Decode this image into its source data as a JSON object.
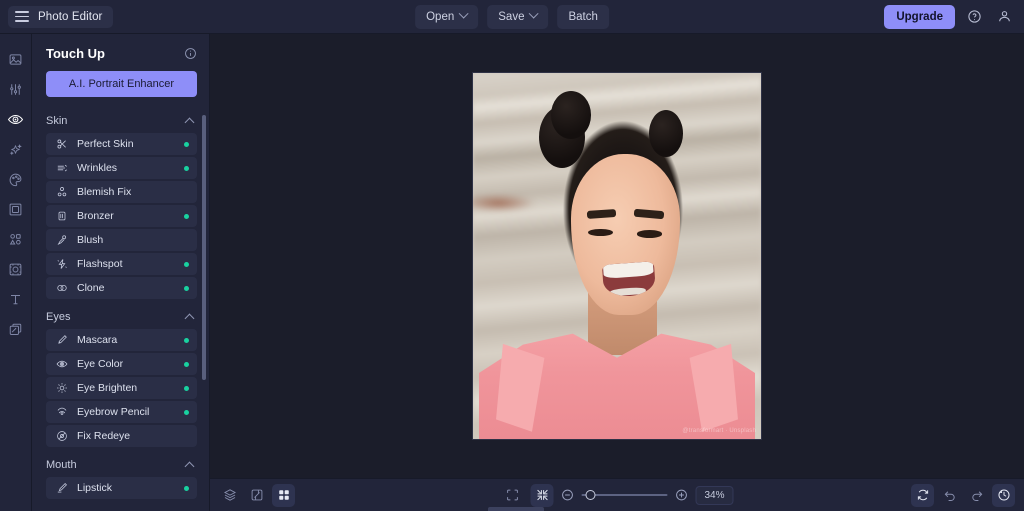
{
  "topbar": {
    "menu_icon": "hamburger-icon",
    "brand": "Photo Editor",
    "buttons": [
      {
        "label": "Open",
        "caret": true
      },
      {
        "label": "Save",
        "caret": true
      },
      {
        "label": "Batch",
        "caret": false
      }
    ],
    "upgrade_label": "Upgrade",
    "help_icon": "help-circle-icon",
    "account_icon": "user-account-icon"
  },
  "rail": {
    "items": [
      {
        "name": "image-icon",
        "active": false
      },
      {
        "name": "adjust-sliders-icon",
        "active": false
      },
      {
        "name": "eye-retouch-icon",
        "active": true
      },
      {
        "name": "sparkles-effects-icon",
        "active": false
      },
      {
        "name": "palette-color-icon",
        "active": false
      },
      {
        "name": "frame-border-icon",
        "active": false
      },
      {
        "name": "shapes-icon",
        "active": false
      },
      {
        "name": "sticker-icon",
        "active": false
      },
      {
        "name": "text-icon",
        "active": false
      },
      {
        "name": "layers-overlay-icon",
        "active": false
      }
    ]
  },
  "panel": {
    "title": "Touch Up",
    "info_icon": "info-circle-icon",
    "ai_button": "A.I. Portrait Enhancer",
    "groups": [
      {
        "name": "Skin",
        "expanded": true,
        "tools": [
          {
            "label": "Perfect Skin",
            "icon": "perfect-skin-icon",
            "pro": true
          },
          {
            "label": "Wrinkles",
            "icon": "wrinkles-icon",
            "pro": true
          },
          {
            "label": "Blemish Fix",
            "icon": "blemish-fix-icon",
            "pro": false
          },
          {
            "label": "Bronzer",
            "icon": "bronzer-icon",
            "pro": true
          },
          {
            "label": "Blush",
            "icon": "blush-brush-icon",
            "pro": false
          },
          {
            "label": "Flashspot",
            "icon": "flashspot-icon",
            "pro": true
          },
          {
            "label": "Clone",
            "icon": "clone-icon",
            "pro": true
          }
        ]
      },
      {
        "name": "Eyes",
        "expanded": true,
        "tools": [
          {
            "label": "Mascara",
            "icon": "mascara-wand-icon",
            "pro": true
          },
          {
            "label": "Eye Color",
            "icon": "eye-color-icon",
            "pro": true
          },
          {
            "label": "Eye Brighten",
            "icon": "eye-brighten-icon",
            "pro": true
          },
          {
            "label": "Eyebrow Pencil",
            "icon": "eyebrow-pencil-icon",
            "pro": true
          },
          {
            "label": "Fix Redeye",
            "icon": "fix-redeye-icon",
            "pro": false
          }
        ]
      },
      {
        "name": "Mouth",
        "expanded": true,
        "tools": [
          {
            "label": "Lipstick",
            "icon": "lipstick-icon",
            "pro": true
          }
        ]
      }
    ]
  },
  "canvas": {
    "watermark": "@transformart · Unsplash",
    "image_alt": "Portrait of a smiling woman with space buns wearing a pink blazer"
  },
  "bottombar": {
    "left_tools": [
      {
        "name": "layers-icon",
        "active": false
      },
      {
        "name": "compare-icon",
        "active": false
      },
      {
        "name": "grid-view-icon",
        "active": true
      }
    ],
    "fit_icon": "fit-screen-icon",
    "actual_icon": "shrink-to-fit-icon",
    "zoom_out_icon": "zoom-out-icon",
    "zoom_in_icon": "zoom-in-icon",
    "zoom_value": "34%",
    "right_tools": [
      {
        "name": "reset-rotate-icon",
        "active": true
      },
      {
        "name": "undo-icon",
        "active": false
      },
      {
        "name": "redo-icon",
        "active": false
      },
      {
        "name": "history-icon",
        "active": true
      }
    ]
  },
  "colors": {
    "accent": "#8e8ef8",
    "pro_dot": "#19d1a0",
    "panel_bg": "#22253a",
    "canvas_bg": "#1b1d2a",
    "row_bg": "#2a2e46"
  }
}
